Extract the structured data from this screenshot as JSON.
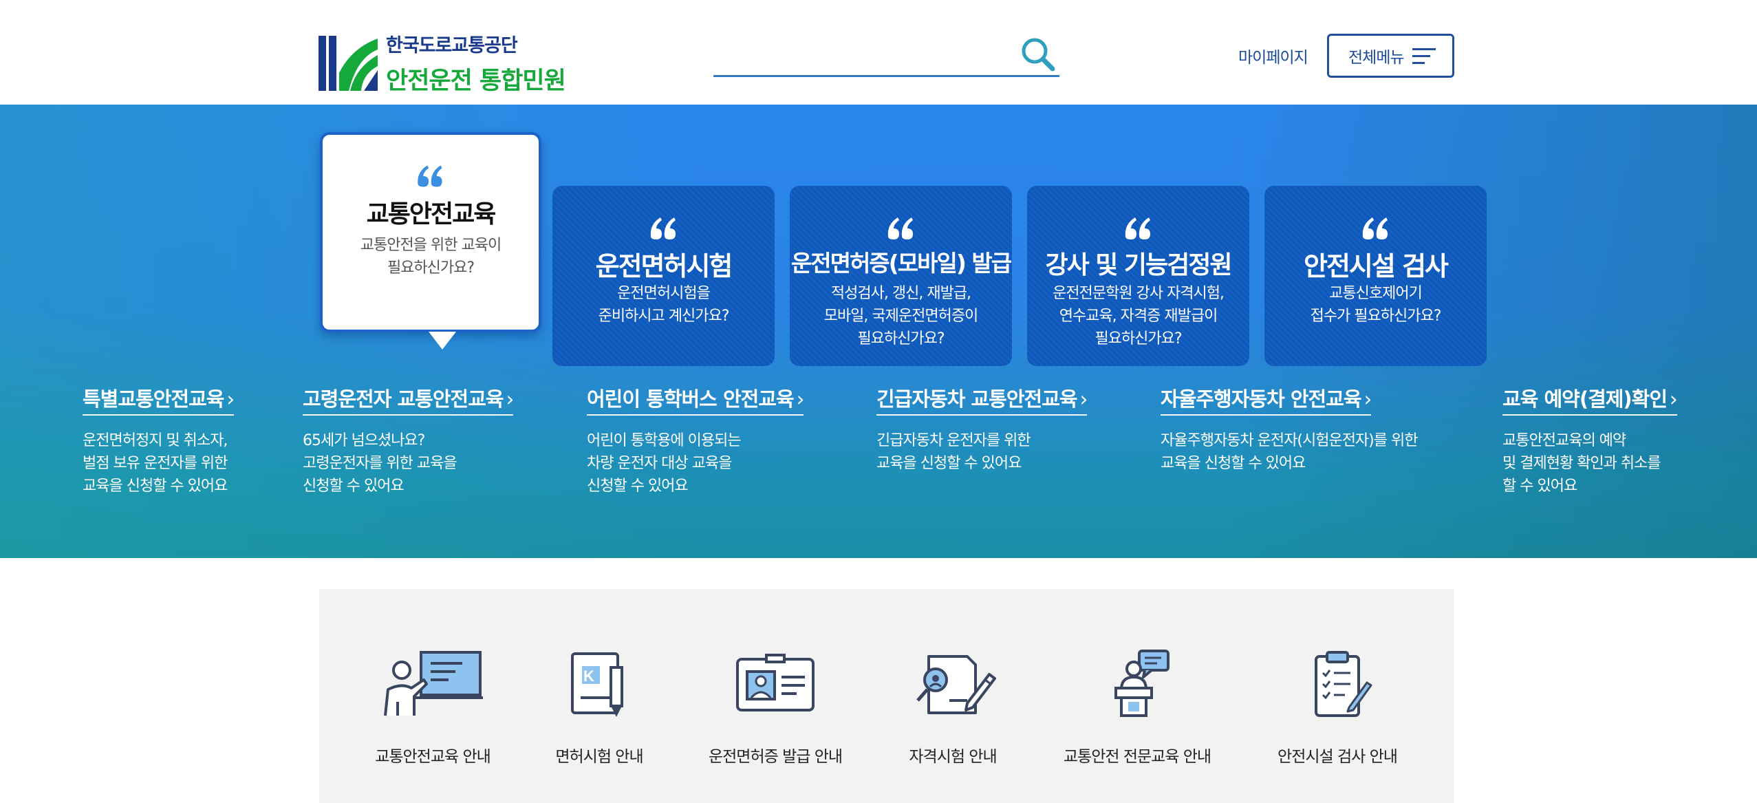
{
  "header": {
    "logo": {
      "org_name": "한국도로교통공단",
      "service_name": "안전운전 통합민원"
    },
    "search": {
      "value": "",
      "placeholder": ""
    },
    "mypage_label": "마이페이지",
    "allmenu_label": "전체메뉴"
  },
  "hero": {
    "cards": [
      {
        "title": "교통안전교육",
        "desc": "교통안전을 위한 교육이\n필요하신가요?",
        "active": true
      },
      {
        "title": "운전면허시험",
        "desc": "운전면허시험을\n준비하시고 계신가요?",
        "active": false
      },
      {
        "title": "운전면허증(모바일) 발급",
        "desc": "적성검사, 갱신, 재발급,\n모바일, 국제운전면허증이\n필요하신가요?",
        "active": false
      },
      {
        "title": "강사 및 기능검정원",
        "desc": "운전전문학원 강사 자격시험,\n연수교육, 자격증 재발급이\n필요하신가요?",
        "active": false
      },
      {
        "title": "안전시설 검사",
        "desc": "교통신호제어기\n접수가 필요하신가요?",
        "active": false
      }
    ],
    "links": [
      {
        "title": "특별교통안전교육",
        "desc": "운전면허정지 및 취소자,\n벌점 보유 운전자를 위한\n교육을 신청할 수 있어요"
      },
      {
        "title": "고령운전자 교통안전교육",
        "desc": "65세가 넘으셨나요?\n고령운전자를 위한 교육을\n신청할 수 있어요"
      },
      {
        "title": "어린이 통학버스 안전교육",
        "desc": "어린이 통학용에 이용되는\n차량 운전자 대상 교육을\n신청할 수 있어요"
      },
      {
        "title": "긴급자동차 교통안전교육",
        "desc": "긴급자동차 운전자를 위한\n교육을 신청할 수 있어요"
      },
      {
        "title": "자율주행자동차 안전교육",
        "desc": "자율주행자동차 운전자(시험운전자)를 위한\n교육을 신청할 수 있어요"
      },
      {
        "title": "교육 예약(결제)확인",
        "desc": "교통안전교육의 예약\n및 결제현황 확인과 취소를\n할 수 있어요"
      }
    ]
  },
  "guide": {
    "items": [
      {
        "label": "교통안전교육 안내",
        "icon": "lecture-board-icon"
      },
      {
        "label": "면허시험 안내",
        "icon": "license-exam-document-icon"
      },
      {
        "label": "운전면허증 발급 안내",
        "icon": "id-card-icon"
      },
      {
        "label": "자격시험 안내",
        "icon": "certificate-exam-icon"
      },
      {
        "label": "교통안전 전문교육 안내",
        "icon": "speaker-podium-icon"
      },
      {
        "label": "안전시설 검사 안내",
        "icon": "checklist-clipboard-icon"
      }
    ]
  },
  "colors": {
    "brand_navy": "#1a3a8c",
    "brand_green": "#15a83a",
    "hero_blue": "#2b86ec",
    "card_blue": "#1157b8",
    "icon_navy": "#3a4660",
    "icon_blue": "#8fc3ef"
  }
}
